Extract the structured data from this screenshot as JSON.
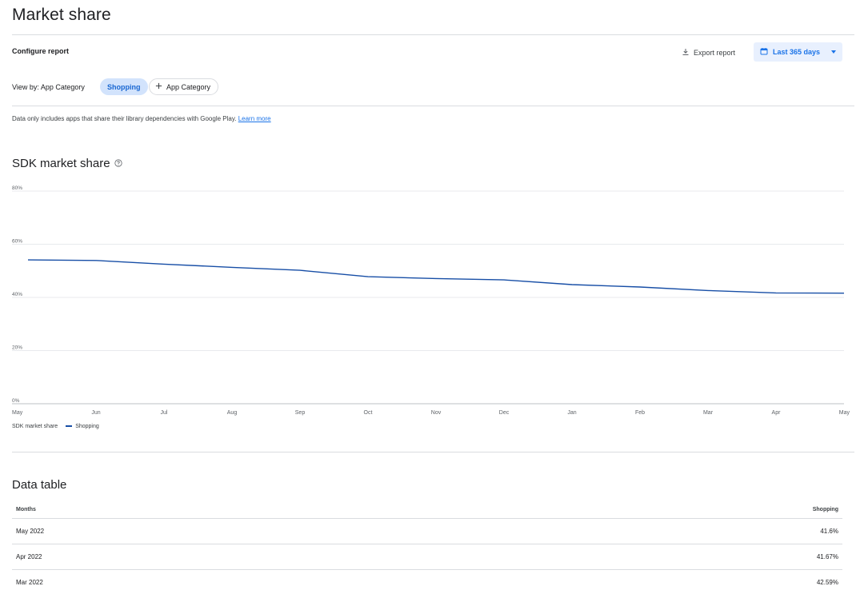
{
  "header": {
    "title": "Market share"
  },
  "toolbar": {
    "configure_label": "Configure report",
    "export_label": "Export report",
    "date_range_label": "Last 365 days"
  },
  "filters": {
    "view_by_label": "View by: App Category",
    "active_chip": "Shopping",
    "add_chip": "App Category"
  },
  "disclaimer": {
    "text": "Data only includes apps that share their library dependencies with Google Play.",
    "link": "Learn more"
  },
  "chart_section": {
    "title": "SDK market share"
  },
  "chart_data": {
    "type": "line",
    "title": "SDK market share",
    "categories": [
      "May",
      "Jun",
      "Jul",
      "Aug",
      "Sep",
      "Oct",
      "Nov",
      "Dec",
      "Jan",
      "Feb",
      "Mar",
      "Apr",
      "May"
    ],
    "series": [
      {
        "name": "Shopping",
        "values": [
          54.1,
          53.9,
          52.5,
          51.3,
          50.2,
          47.8,
          47.1,
          46.6,
          44.8,
          43.9,
          42.59,
          41.67,
          41.6
        ]
      }
    ],
    "y_ticks": [
      "80%",
      "60%",
      "40%",
      "20%",
      "0%"
    ],
    "ylim": [
      0,
      80
    ],
    "grid": true,
    "line_color": "#174ea6"
  },
  "legend": {
    "label": "SDK market share",
    "series": "Shopping"
  },
  "table_section": {
    "title": "Data table"
  },
  "table": {
    "columns": [
      "Months",
      "Shopping"
    ],
    "rows": [
      [
        "May 2022",
        "41.6%"
      ],
      [
        "Apr 2022",
        "41.67%"
      ],
      [
        "Mar 2022",
        "42.59%"
      ]
    ]
  }
}
